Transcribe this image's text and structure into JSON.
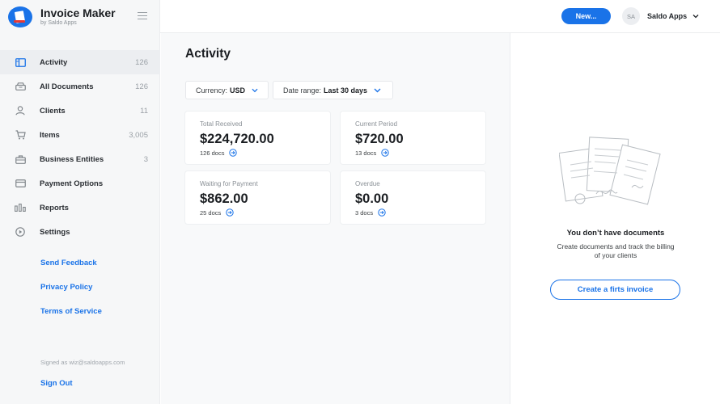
{
  "brand": {
    "title": "Invoice Maker",
    "subtitle": "by Saldo Apps"
  },
  "header": {
    "new_label": "New...",
    "user_initials": "SA",
    "user_name": "Saldo Apps"
  },
  "sidebar": {
    "items": [
      {
        "label": "Activity",
        "count": "126",
        "icon": "activity-icon"
      },
      {
        "label": "All Documents",
        "count": "126",
        "icon": "documents-icon"
      },
      {
        "label": "Clients",
        "count": "11",
        "icon": "user-icon"
      },
      {
        "label": "Items",
        "count": "3,005",
        "icon": "cart-icon"
      },
      {
        "label": "Business Entities",
        "count": "3",
        "icon": "briefcase-icon"
      },
      {
        "label": "Payment Options",
        "count": "",
        "icon": "credit-card-icon"
      },
      {
        "label": "Reports",
        "count": "",
        "icon": "bar-chart-icon"
      },
      {
        "label": "Settings",
        "count": "",
        "icon": "settings-icon"
      }
    ],
    "links": [
      "Send Feedback",
      "Privacy Policy",
      "Terms of Service"
    ],
    "signed_in": "Signed as wiz@saldoapps.com",
    "sign_out": "Sign Out"
  },
  "main": {
    "title": "Activity",
    "filters": {
      "currency_label": "Currency:",
      "currency_value": "USD",
      "range_label": "Date range:",
      "range_value": "Last 30 days"
    },
    "cards": [
      {
        "label": "Total Received",
        "value": "$224,720.00",
        "docs": "126 docs"
      },
      {
        "label": "Current Period",
        "value": "$720.00",
        "docs": "13 docs"
      },
      {
        "label": "Waiting for Payment",
        "value": "$862.00",
        "docs": "25 docs"
      },
      {
        "label": "Overdue",
        "value": "$0.00",
        "docs": "3 docs"
      }
    ]
  },
  "empty": {
    "title": "You don’t have documents",
    "text": "Create documents and track the billing of your clients",
    "button": "Create a firts invoice"
  },
  "colors": {
    "accent": "#1a73e8",
    "sidebar_bg": "#f6f7f8",
    "main_bg": "#f8f9fa"
  }
}
